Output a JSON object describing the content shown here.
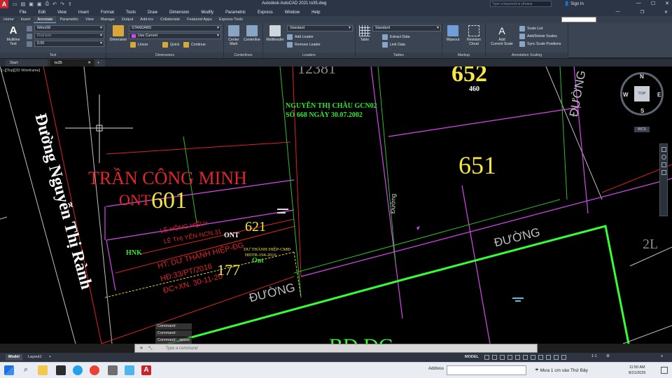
{
  "titlebar": {
    "app_title": "Autodesk AutoCAD 2021   to35.dwg",
    "search_placeholder": "Type a keyword or phrase",
    "sign_in": "Sign In",
    "logo_letter": "A"
  },
  "menu": [
    "File",
    "Edit",
    "View",
    "Insert",
    "Format",
    "Tools",
    "Draw",
    "Dimension",
    "Modify",
    "Parametric",
    "Express",
    "Window",
    "Help"
  ],
  "ribbon_tabs": [
    "Home",
    "Insert",
    "Annotate",
    "Parametric",
    "View",
    "Manage",
    "Output",
    "Add-ins",
    "Collaborate",
    "Featured Apps",
    "Express Tools"
  ],
  "active_ribbon_tab": "Annotate",
  "ribbon": {
    "text_panel": {
      "title": "Text",
      "multiline_text": "Multiline\nText",
      "style": "Wimo58",
      "find_placeholder": "Find text",
      "height": "0.00"
    },
    "dimensions_panel": {
      "title": "Dimensions",
      "dimension": "Dimension",
      "style": "STANDARD",
      "layer": "Use Current",
      "linear": "Linear",
      "quick": "Quick",
      "continue": "Continue"
    },
    "centerlines_panel": {
      "title": "Centerlines",
      "center_mark": "Center\nMark",
      "centerline": "Centerline"
    },
    "leaders_panel": {
      "title": "Leaders",
      "multileader": "Multileader",
      "style": "Standard",
      "add_leader": "Add Leader",
      "remove_leader": "Remove Leader"
    },
    "tables_panel": {
      "title": "Tables",
      "table": "Table",
      "style": "Standard",
      "extract_data": "Extract Data",
      "link_data": "Link Data"
    },
    "markup_panel": {
      "title": "Markup",
      "wipeout": "Wipeout",
      "revision_cloud": "Revision\nCloud"
    },
    "annotation_scaling_panel": {
      "title": "Annotation Scaling",
      "add_current_scale": "Add\nCurrent Scale",
      "scale_list": "Scale List",
      "add_delete_scales": "Add/Delete Scales",
      "sync_scale_positions": "Sync Scale Positions"
    }
  },
  "doc_tabs": [
    "Start",
    "to35"
  ],
  "viewport_label": "[−][Top][2D Wireframe]",
  "drawing": {
    "street_left": "Đường Nguyễn Thị Rành",
    "owner_main": "TRẦN CÔNG MINH",
    "owner_main_code": "ONT",
    "parcel_601": "601",
    "parcel_652": "652",
    "parcel_652_sub": "460",
    "parcel_651": "651",
    "parcel_621": "621",
    "parcel_621_code": "ONT",
    "parcel_177": "177",
    "parcel_177_code": "Ont",
    "top_label": "NGUYỄN THỊ CHÂU GCN02",
    "top_label_2": "SỐ 668 NGÀY 30.07.2002",
    "le_hong_hieu": "LÊ HỒNG HIẾU+",
    "le_thi_yen": "LÊ THỊ YẾN-NCN.31",
    "hnk": "HNK",
    "du_thanh_hiep_a": "HT: DƯ THÀNH HIỆP-ĐG",
    "du_thanh_hiep_b": "HĐ:33/PT/2016",
    "du_thanh_hiep_c": "ĐC+XN. 30-11-20",
    "du_thanh_hiep_small_a": "DƯ THÀNH HIỆP-CMĐ",
    "du_thanh_hiep_small_b": "HĐTB-194-2016",
    "duong_1": "ĐƯỜNG",
    "duong_2": "ĐƯỜNG",
    "duong_3": "ĐƯỜNG",
    "duong_vertical": "Đường",
    "bd_dg": "BĐ ĐG",
    "top_partial": "12381",
    "right_partial": "2L"
  },
  "viewcube": {
    "n": "N",
    "s": "S",
    "e": "E",
    "w": "W",
    "top": "TOP",
    "wcs": "WCS"
  },
  "command": {
    "history": [
      "Command:",
      "Command:",
      "Command: _qsave"
    ],
    "placeholder": "Type a command"
  },
  "layout_tabs": [
    "Model",
    "Layout1"
  ],
  "status": {
    "model": "MODEL",
    "scale": "1:1"
  },
  "taskbar": {
    "address_label": "Address",
    "weather": "Mưa 1 cm vào Thứ Bảy",
    "time": "11:50 AM",
    "date": "8/21/2025"
  },
  "colors": {
    "parcel_boundary_magenta": "#d946ef",
    "parcel_boundary_green": "#22dd22",
    "label_yellow": "#f5e642",
    "label_red": "#e3262b",
    "label_green": "#2ee82e",
    "bright_green_line": "#33ff33"
  }
}
